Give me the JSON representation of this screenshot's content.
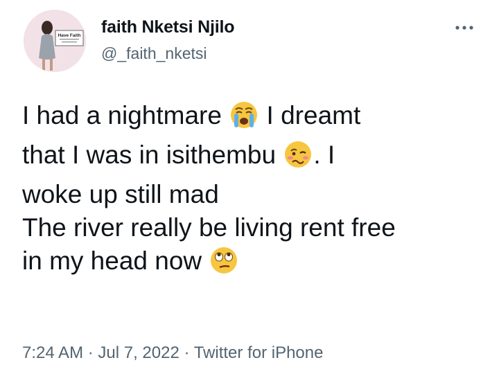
{
  "author": {
    "display_name": "faith Nketsi Njilo",
    "handle": "@_faith_nketsi",
    "avatar_sign_text": "Have Faith"
  },
  "tweet": {
    "line1_a": "I had a nightmare ",
    "line1_b": " I dreamt",
    "line2_a": "that I was in isithembu ",
    "line2_b": ". I",
    "line3": "woke up still mad",
    "line4": "The river really be living rent free",
    "line5": "in my head now ",
    "emojis": [
      "loudly-crying-face",
      "woozy-face",
      "face-with-rolling-eyes"
    ]
  },
  "meta": {
    "time": "7:24 AM",
    "sep1": " · ",
    "date": "Jul 7, 2022",
    "sep2": " · ",
    "source": "Twitter for iPhone"
  },
  "colors": {
    "text": "#0f1419",
    "secondary": "#536471",
    "emoji_yellow": "#f7c640"
  }
}
